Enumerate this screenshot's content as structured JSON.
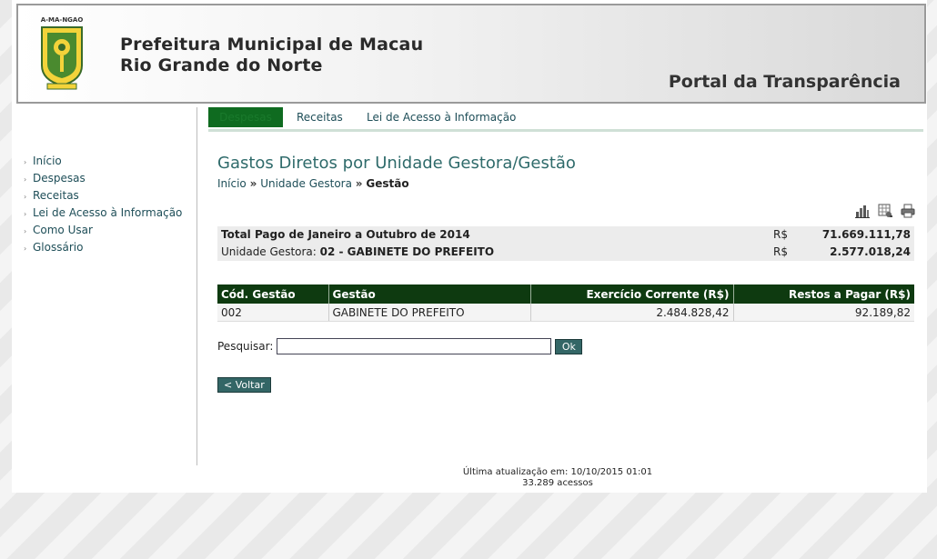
{
  "header": {
    "title_line1": "Prefeitura Municipal de Macau",
    "title_line2": "Rio Grande do Norte",
    "portal": "Portal da Transparência",
    "logo_text": "A-MA-NGAO"
  },
  "tabs": [
    {
      "label": "Despesas",
      "active": true
    },
    {
      "label": "Receitas",
      "active": false
    },
    {
      "label": "Lei de Acesso à Informação",
      "active": false
    }
  ],
  "sidebar": {
    "items": [
      {
        "label": "Início"
      },
      {
        "label": "Despesas"
      },
      {
        "label": "Receitas"
      },
      {
        "label": "Lei de Acesso à Informação"
      },
      {
        "label": "Como Usar"
      },
      {
        "label": "Glossário"
      }
    ]
  },
  "page": {
    "title": "Gastos Diretos por Unidade Gestora/Gestão",
    "breadcrumb": {
      "home": "Início",
      "sep": "»",
      "level2": "Unidade Gestora",
      "current": "Gestão"
    }
  },
  "toolbar_icons": [
    "chart-icon",
    "spreadsheet-icon",
    "print-icon"
  ],
  "summary": {
    "total_label": "Total Pago de Janeiro a Outubro de 2014",
    "total_currency": "R$",
    "total_value": "71.669.111,78",
    "unit_label": "Unidade Gestora: ",
    "unit_name": "02 - GABINETE DO PREFEITO",
    "unit_currency": "R$",
    "unit_value": "2.577.018,24"
  },
  "table": {
    "headers": [
      "Cód. Gestão",
      "Gestão",
      "Exercício Corrente (R$)",
      "Restos a Pagar (R$)"
    ],
    "rows": [
      [
        "002",
        "GABINETE DO PREFEITO",
        "2.484.828,42",
        "92.189,82"
      ]
    ]
  },
  "search": {
    "label": "Pesquisar:",
    "value": "",
    "button": "Ok"
  },
  "back_button": "< Voltar",
  "footer": {
    "updated": "Última atualização em: 10/10/2015 01:01",
    "visits": "33.289 acessos"
  },
  "colors": {
    "accent": "#0e3a10",
    "link": "#1e4e58",
    "title": "#2f6b6b",
    "button": "#336666"
  }
}
